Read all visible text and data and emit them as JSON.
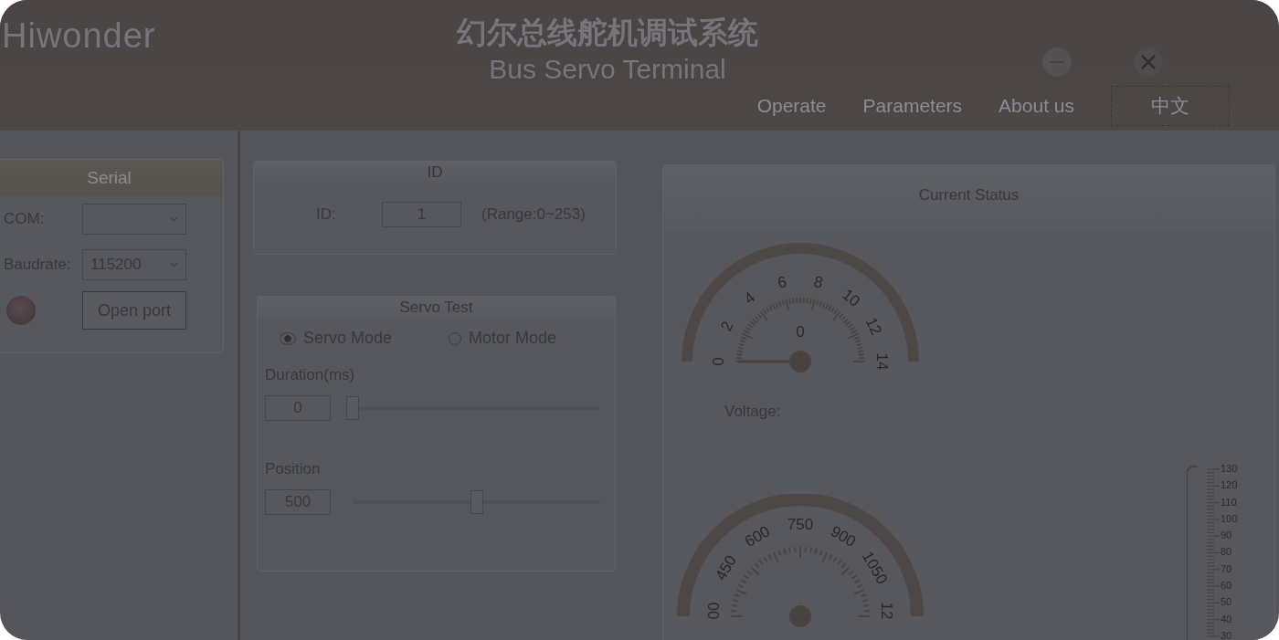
{
  "header": {
    "logo": "Hiwonder",
    "title": "幻尔总线舵机调试系统",
    "subtitle": "Bus Servo Terminal",
    "nav": [
      {
        "label": "Operate",
        "kind": "link"
      },
      {
        "label": "Parameters",
        "kind": "link"
      },
      {
        "label": "About us",
        "kind": "link"
      },
      {
        "label": "中文",
        "kind": "button"
      }
    ]
  },
  "serial": {
    "title": "Serial",
    "com_label": "COM:",
    "baud_label": "Baudrate:",
    "baud_value": "115200",
    "connected": false,
    "open_button": "Open port"
  },
  "id_panel": {
    "title": "ID",
    "label": "ID:",
    "value": "1",
    "range": "(Range:0~253)"
  },
  "servo_test": {
    "title": "Servo Test",
    "modes": [
      {
        "label": "Servo Mode",
        "selected": true
      },
      {
        "label": "Motor Mode",
        "selected": false
      }
    ],
    "duration": {
      "label": "Duration(ms)",
      "value": "0",
      "level": 0
    },
    "position": {
      "label": "Position",
      "value": "500",
      "level": 0.5
    }
  },
  "status": {
    "title": "Current Status",
    "voltage_gauge": {
      "reading": "0",
      "labels": [
        "0",
        "2",
        "4",
        "6",
        "8",
        "10",
        "12",
        "14"
      ]
    },
    "voltage_label": "Voltage:",
    "position_gauge": {
      "labels": [
        "00",
        "450",
        "600",
        "750",
        "900",
        "1050",
        "12"
      ]
    },
    "thermometer": {
      "labels": [
        "130",
        "120",
        "110",
        "100",
        "90",
        "80",
        "70",
        "60",
        "50",
        "40",
        "30"
      ]
    }
  }
}
